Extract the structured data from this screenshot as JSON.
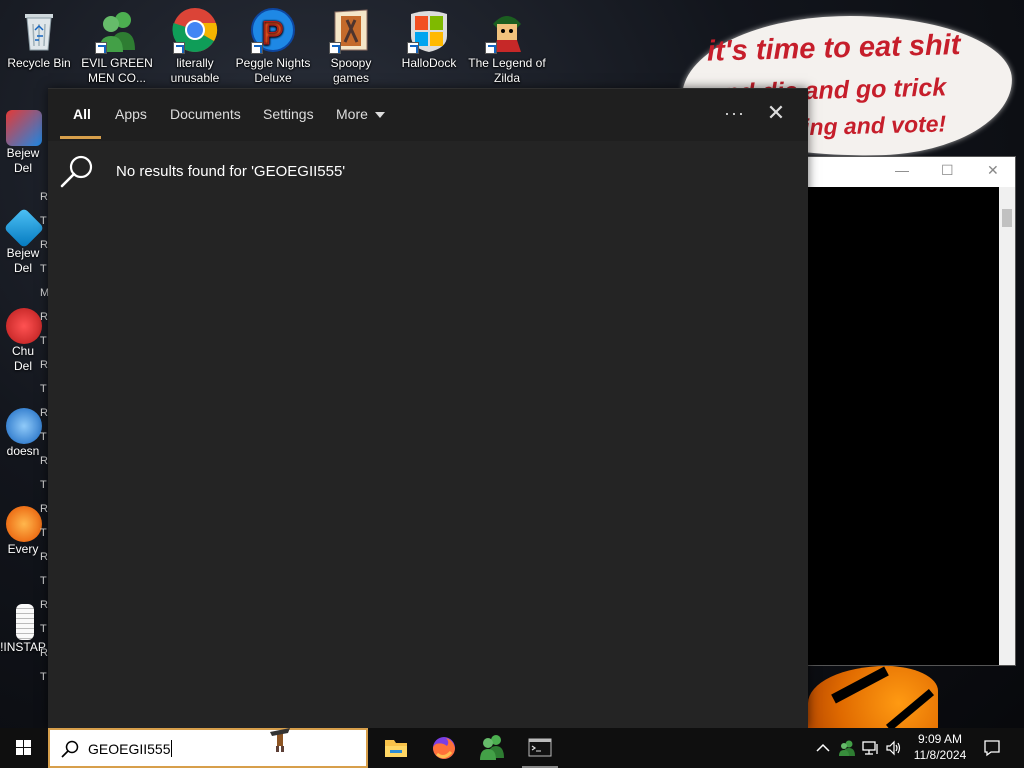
{
  "desktop": {
    "icons": [
      {
        "label": "Recycle Bin",
        "icon": "recycle-bin-icon"
      },
      {
        "label": "EVIL GREEN MEN CO...",
        "icon": "green-men-icon"
      },
      {
        "label": "literally unusable",
        "icon": "chrome-icon"
      },
      {
        "label": "Peggle Nights Deluxe",
        "icon": "peggle-icon"
      },
      {
        "label": "Spoopy games",
        "icon": "spoopy-games-icon"
      },
      {
        "label": "HalloDock",
        "icon": "windows-logo-icon"
      },
      {
        "label": "The Legend of Zilda",
        "icon": "zilda-icon"
      }
    ],
    "left_icons": [
      {
        "label": "Bejew\nDel"
      },
      {
        "label": "Bejew\nDel"
      },
      {
        "label": "Chu\nDel"
      },
      {
        "label": "doesn"
      },
      {
        "label": "Every"
      },
      {
        "label": "!INSTAP"
      }
    ],
    "left_strip_letters": [
      "R",
      "T",
      "R",
      "T",
      "M",
      "R",
      "T",
      "R",
      "T",
      "R",
      "T",
      "R",
      "T",
      "R",
      "T",
      "R",
      "T",
      "R",
      "T",
      "R",
      "T"
    ],
    "bubble_line1": "it's time to eat shit",
    "bubble_line2": "and die and go trick",
    "bubble_line3": "ing and vote!"
  },
  "search_panel": {
    "tabs": [
      "All",
      "Apps",
      "Documents",
      "Settings",
      "More"
    ],
    "active_tab": "All",
    "no_results_text": "No results found for 'GEOEGII555'"
  },
  "taskbar": {
    "search_value": "GEOEGII555",
    "apps": [
      {
        "name": "file-explorer-icon"
      },
      {
        "name": "firefox-icon"
      },
      {
        "name": "green-men-icon"
      },
      {
        "name": "terminal-icon"
      }
    ],
    "time": "9:09 AM",
    "date": "11/8/2024"
  },
  "colors": {
    "accent": "#d79f4b",
    "panel_bg": "#242424",
    "panel_header_bg": "#1f1f1f",
    "taskbar_bg": "#0f0f0f"
  }
}
